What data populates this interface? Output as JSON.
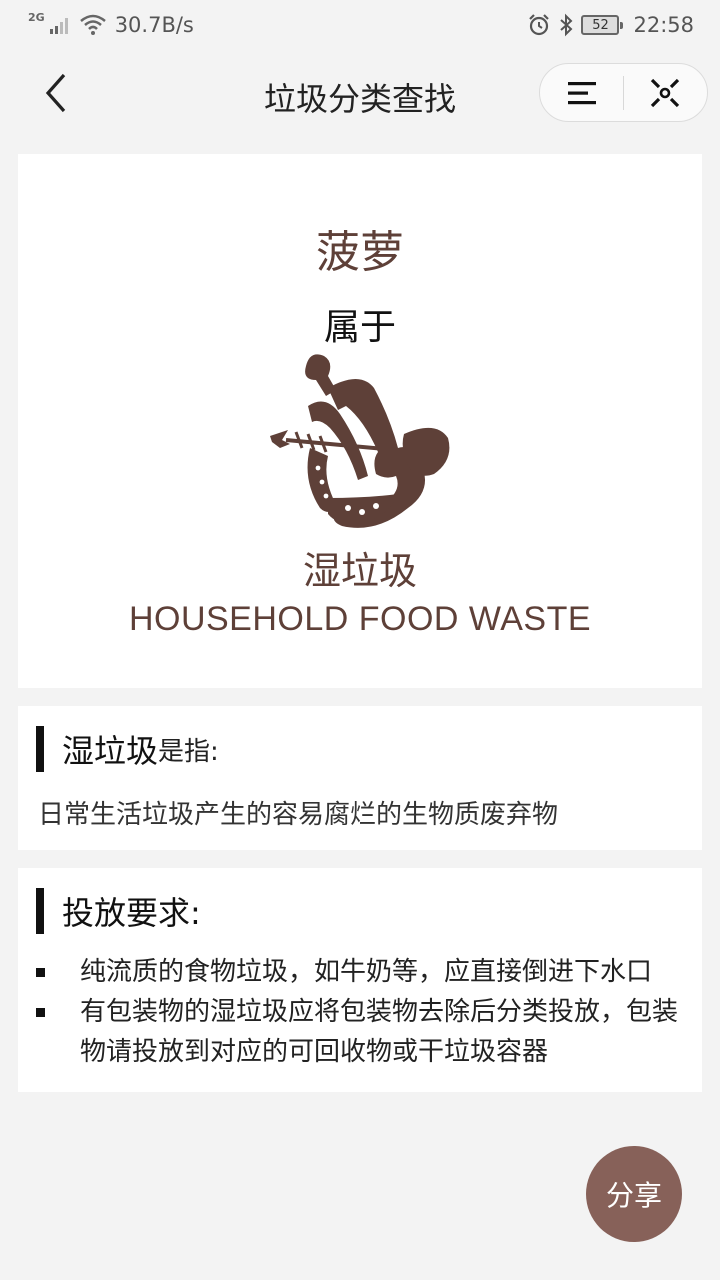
{
  "status_bar": {
    "network_type": "2G",
    "speed": "30.7B/s",
    "battery": "52",
    "time": "22:58"
  },
  "nav": {
    "title": "垃圾分类查找"
  },
  "result": {
    "item_name": "菠萝",
    "belongs_to": "属于",
    "category_cn": "湿垃圾",
    "category_en": "HOUSEHOLD FOOD WASTE",
    "category_icon": "food-waste-icon",
    "brand_color": "#5e4038"
  },
  "definition": {
    "title": "湿垃圾",
    "title_suffix": "是指:",
    "text": "日常生活垃圾产生的容易腐烂的生物质废弃物"
  },
  "requirements": {
    "title": "投放要求:",
    "items": [
      "纯流质的食物垃圾，如牛奶等，应直接倒进下水口",
      "有包装物的湿垃圾应将包装物去除后分类投放，包装物请投放到对应的可回收物或干垃圾容器"
    ]
  },
  "share_button": {
    "label": "分享",
    "color": "#876159"
  }
}
